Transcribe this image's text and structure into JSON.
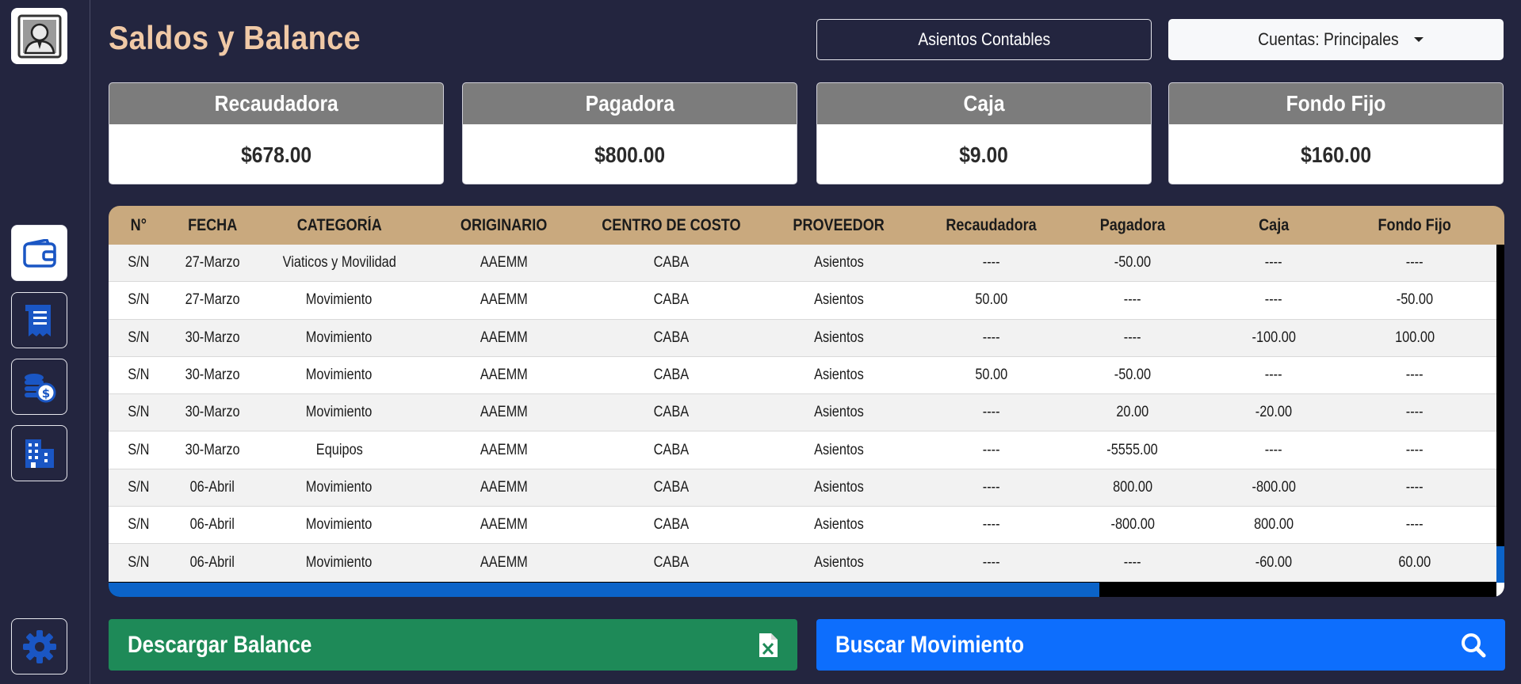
{
  "header": {
    "title": "Saldos y Balance",
    "asientos_label": "Asientos Contables",
    "cuentas_label": "Cuentas: Principales"
  },
  "sidebar": {
    "items": [
      {
        "name": "avatar",
        "icon": "user-avatar-icon"
      },
      {
        "name": "wallet",
        "icon": "wallet-icon",
        "active": true
      },
      {
        "name": "receipts",
        "icon": "receipt-icon"
      },
      {
        "name": "coins",
        "icon": "coins-dollar-icon"
      },
      {
        "name": "buildings",
        "icon": "buildings-icon"
      },
      {
        "name": "settings",
        "icon": "gear-icon"
      }
    ]
  },
  "cards": [
    {
      "title": "Recaudadora",
      "value": "$678.00"
    },
    {
      "title": "Pagadora",
      "value": "$800.00"
    },
    {
      "title": "Caja",
      "value": "$9.00"
    },
    {
      "title": "Fondo Fijo",
      "value": "$160.00"
    }
  ],
  "table": {
    "headers": [
      "N°",
      "FECHA",
      "CATEGORÍA",
      "ORIGINARIO",
      "CENTRO DE COSTO",
      "PROVEEDOR",
      "Recaudadora",
      "Pagadora",
      "Caja",
      "Fondo Fijo"
    ],
    "rows": [
      [
        "S/N",
        "27-Marzo",
        "Viaticos y Movilidad",
        "AAEMM",
        "CABA",
        "Asientos",
        "----",
        "-50.00",
        "----",
        "----"
      ],
      [
        "S/N",
        "27-Marzo",
        "Movimiento",
        "AAEMM",
        "CABA",
        "Asientos",
        "50.00",
        "----",
        "----",
        "-50.00"
      ],
      [
        "S/N",
        "30-Marzo",
        "Movimiento",
        "AAEMM",
        "CABA",
        "Asientos",
        "----",
        "----",
        "-100.00",
        "100.00"
      ],
      [
        "S/N",
        "30-Marzo",
        "Movimiento",
        "AAEMM",
        "CABA",
        "Asientos",
        "50.00",
        "-50.00",
        "----",
        "----"
      ],
      [
        "S/N",
        "30-Marzo",
        "Movimiento",
        "AAEMM",
        "CABA",
        "Asientos",
        "----",
        "20.00",
        "-20.00",
        "----"
      ],
      [
        "S/N",
        "30-Marzo",
        "Equipos",
        "AAEMM",
        "CABA",
        "Asientos",
        "----",
        "-5555.00",
        "----",
        "----"
      ],
      [
        "S/N",
        "06-Abril",
        "Movimiento",
        "AAEMM",
        "CABA",
        "Asientos",
        "----",
        "800.00",
        "-800.00",
        "----"
      ],
      [
        "S/N",
        "06-Abril",
        "Movimiento",
        "AAEMM",
        "CABA",
        "Asientos",
        "----",
        "-800.00",
        "800.00",
        "----"
      ],
      [
        "S/N",
        "06-Abril",
        "Movimiento",
        "AAEMM",
        "CABA",
        "Asientos",
        "----",
        "----",
        "-60.00",
        "60.00"
      ]
    ]
  },
  "actions": {
    "download_label": "Descargar Balance",
    "download_icon": "excel-file-icon",
    "search_label": "Buscar Movimiento",
    "search_icon": "search-icon"
  },
  "colors": {
    "background": "#23253f",
    "title": "#f0c9a6",
    "table_header": "#c9a97e",
    "card_header": "#7c7c7c",
    "download": "#1e8a58",
    "search": "#0d6efd",
    "accent_icon": "#1a56c4"
  }
}
